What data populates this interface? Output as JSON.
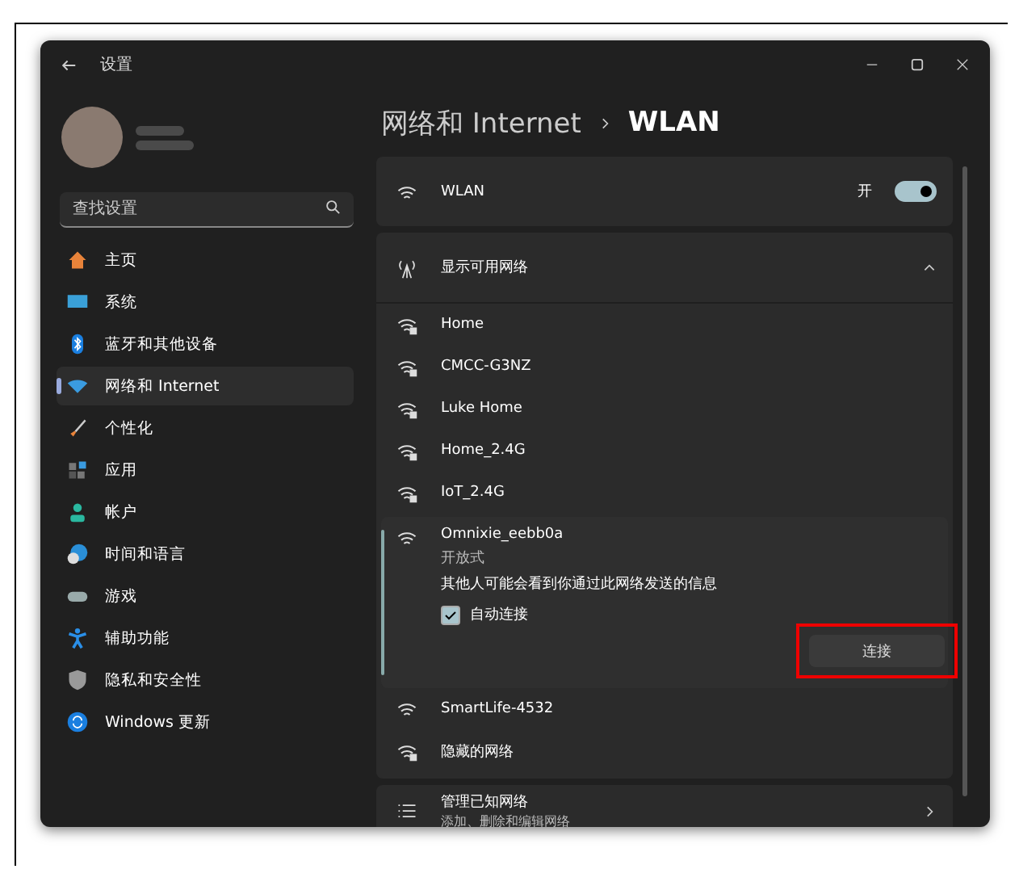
{
  "window": {
    "title": "设置"
  },
  "search": {
    "placeholder": "查找设置"
  },
  "nav": [
    {
      "label": "主页",
      "kind": "home",
      "selected": false
    },
    {
      "label": "系统",
      "kind": "system",
      "selected": false
    },
    {
      "label": "蓝牙和其他设备",
      "kind": "bluetooth",
      "selected": false
    },
    {
      "label": "网络和 Internet",
      "kind": "network",
      "selected": true
    },
    {
      "label": "个性化",
      "kind": "brush",
      "selected": false
    },
    {
      "label": "应用",
      "kind": "apps",
      "selected": false
    },
    {
      "label": "帐户",
      "kind": "account",
      "selected": false
    },
    {
      "label": "时间和语言",
      "kind": "time",
      "selected": false
    },
    {
      "label": "游戏",
      "kind": "game",
      "selected": false
    },
    {
      "label": "辅助功能",
      "kind": "access",
      "selected": false
    },
    {
      "label": "隐私和安全性",
      "kind": "shield",
      "selected": false
    },
    {
      "label": "Windows 更新",
      "kind": "update",
      "selected": false
    }
  ],
  "breadcrumb": [
    "网络和 Internet",
    "WLAN"
  ],
  "wlan": {
    "label": "WLAN",
    "state_label": "开",
    "on": true
  },
  "available": {
    "label": "显示可用网络",
    "expanded": true,
    "networks": [
      {
        "name": "Home",
        "secured": true,
        "expanded": false
      },
      {
        "name": "CMCC-G3NZ",
        "secured": true,
        "expanded": false
      },
      {
        "name": "Luke Home",
        "secured": true,
        "expanded": false
      },
      {
        "name": "Home_2.4G",
        "secured": true,
        "expanded": false
      },
      {
        "name": "IoT_2.4G",
        "secured": true,
        "expanded": false
      },
      {
        "name": "Omnixie_eebb0a",
        "secured": false,
        "expanded": true,
        "security": "开放式",
        "warning": "其他人可能会看到你通过此网络发送的信息",
        "auto_connect": {
          "label": "自动连接",
          "checked": true
        },
        "connect_label": "连接"
      },
      {
        "name": "SmartLife-4532",
        "secured": false,
        "expanded": false
      },
      {
        "name": "隐藏的网络",
        "secured": true,
        "expanded": false
      }
    ]
  },
  "manage": {
    "title": "管理已知网络",
    "subtitle": "添加、删除和编辑网络"
  }
}
